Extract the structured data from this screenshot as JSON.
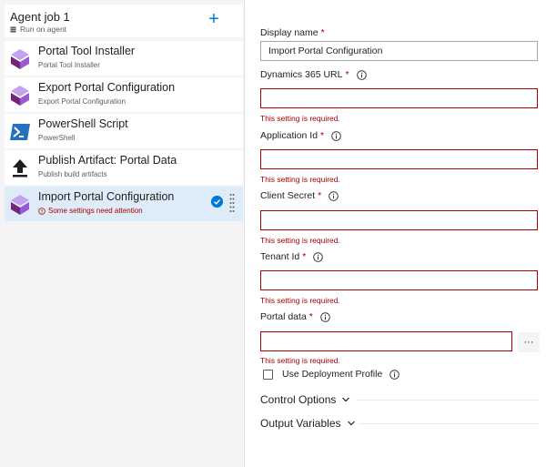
{
  "job": {
    "title": "Agent job 1",
    "subtitle": "Run on agent",
    "add_label": "+"
  },
  "tasks": [
    {
      "title": "Portal Tool Installer",
      "subtitle": "Portal Tool Installer",
      "icon": "powerapps-icon"
    },
    {
      "title": "Export Portal Configuration",
      "subtitle": "Export Portal Configuration",
      "icon": "powerapps-icon"
    },
    {
      "title": "PowerShell Script",
      "subtitle": "PowerShell",
      "icon": "powershell-icon"
    },
    {
      "title": "Publish Artifact: Portal Data",
      "subtitle": "Publish build artifacts",
      "icon": "upload-icon"
    },
    {
      "title": "Import Portal Configuration",
      "subtitle": "Some settings need attention",
      "icon": "powerapps-icon",
      "selected": true
    }
  ],
  "form": {
    "display_name": {
      "label": "Display name",
      "value": "Import Portal Configuration"
    },
    "dynamics_url": {
      "label": "Dynamics 365 URL",
      "value": ""
    },
    "application_id": {
      "label": "Application Id",
      "value": ""
    },
    "client_secret": {
      "label": "Client Secret",
      "value": ""
    },
    "tenant_id": {
      "label": "Tenant Id",
      "value": ""
    },
    "portal_data": {
      "label": "Portal data",
      "value": ""
    },
    "required_marker": "*",
    "error_message": "This setting is required.",
    "browse_label": "···",
    "use_deployment_profile": {
      "label": "Use Deployment Profile",
      "checked": false
    }
  },
  "sections": {
    "control_options": "Control Options",
    "output_variables": "Output Variables"
  },
  "colors": {
    "accent": "#0078d4",
    "error": "#a80000",
    "selected_bg": "#deecf9"
  }
}
